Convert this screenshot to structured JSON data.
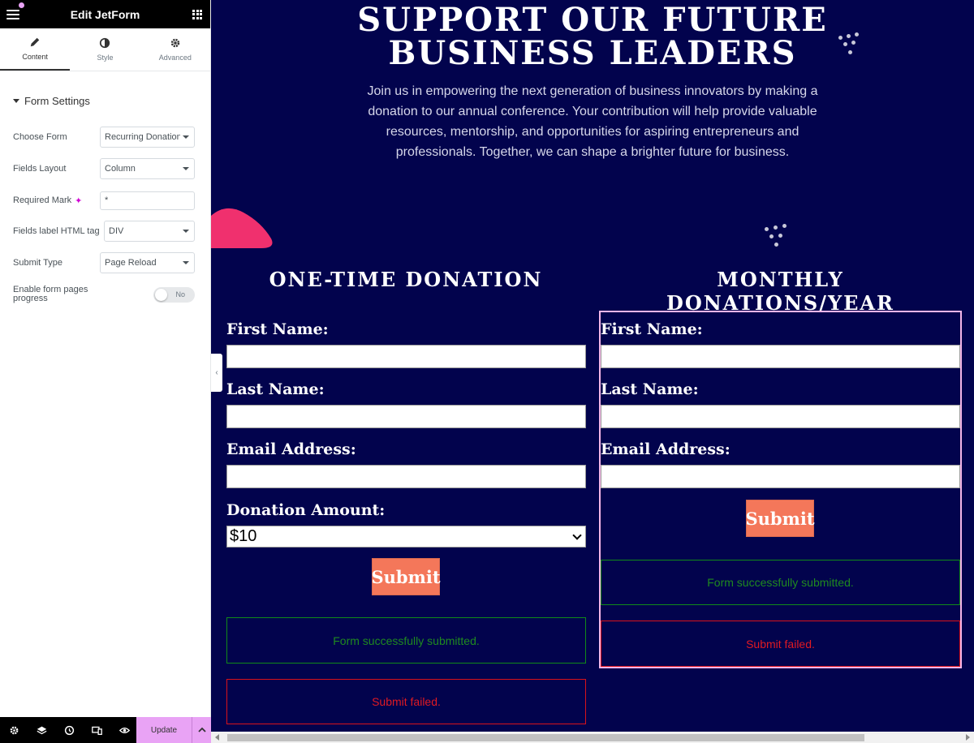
{
  "panel": {
    "title": "Edit JetForm",
    "tabs": [
      {
        "label": "Content",
        "icon": "pencil-icon"
      },
      {
        "label": "Style",
        "icon": "contrast-icon"
      },
      {
        "label": "Advanced",
        "icon": "gear-icon"
      }
    ],
    "section": "Form Settings",
    "controls": {
      "choose_form": {
        "label": "Choose Form",
        "value": "Recurring Donation"
      },
      "fields_layout": {
        "label": "Fields Layout",
        "value": "Column"
      },
      "required_mark": {
        "label": "Required Mark",
        "value": "*"
      },
      "fields_label_tag": {
        "label": "Fields label HTML tag",
        "value": "DIV"
      },
      "submit_type": {
        "label": "Submit Type",
        "value": "Page Reload"
      },
      "form_pages_progress": {
        "label": "Enable form pages progress",
        "value": "No"
      }
    },
    "footer": {
      "update_label": "Update"
    }
  },
  "preview": {
    "hero": {
      "title_line1": "SUPPORT OUR FUTURE",
      "title_line2": "BUSINESS LEADERS",
      "text": "Join us in empowering the next generation of business innovators by making a donation to our annual conference. Your contribution will help provide valuable resources, mentorship, and opportunities for aspiring entrepreneurs and professionals. Together, we can shape a brighter future for business."
    },
    "one_time": {
      "title": "ONE-TIME DONATION",
      "first_name": "First Name:",
      "last_name": "Last Name:",
      "email": "Email Address:",
      "amount_label": "Donation Amount:",
      "amount_value": "$10",
      "submit": "Submit",
      "success": "Form successfully submitted.",
      "fail": "Submit failed."
    },
    "monthly": {
      "title": "MONTHLY DONATIONS/YEAR",
      "first_name": "First Name:",
      "last_name": "Last Name:",
      "email": "Email Address:",
      "submit": "Submit",
      "success": "Form successfully submitted.",
      "fail": "Submit failed."
    }
  },
  "colors": {
    "preview_bg": "#02034d",
    "accent_pink": "#e9a3f5",
    "submit_orange": "#f4775a",
    "blob_pink": "#f0306e",
    "success_green": "#118a18",
    "fail_red": "#d9121a"
  }
}
